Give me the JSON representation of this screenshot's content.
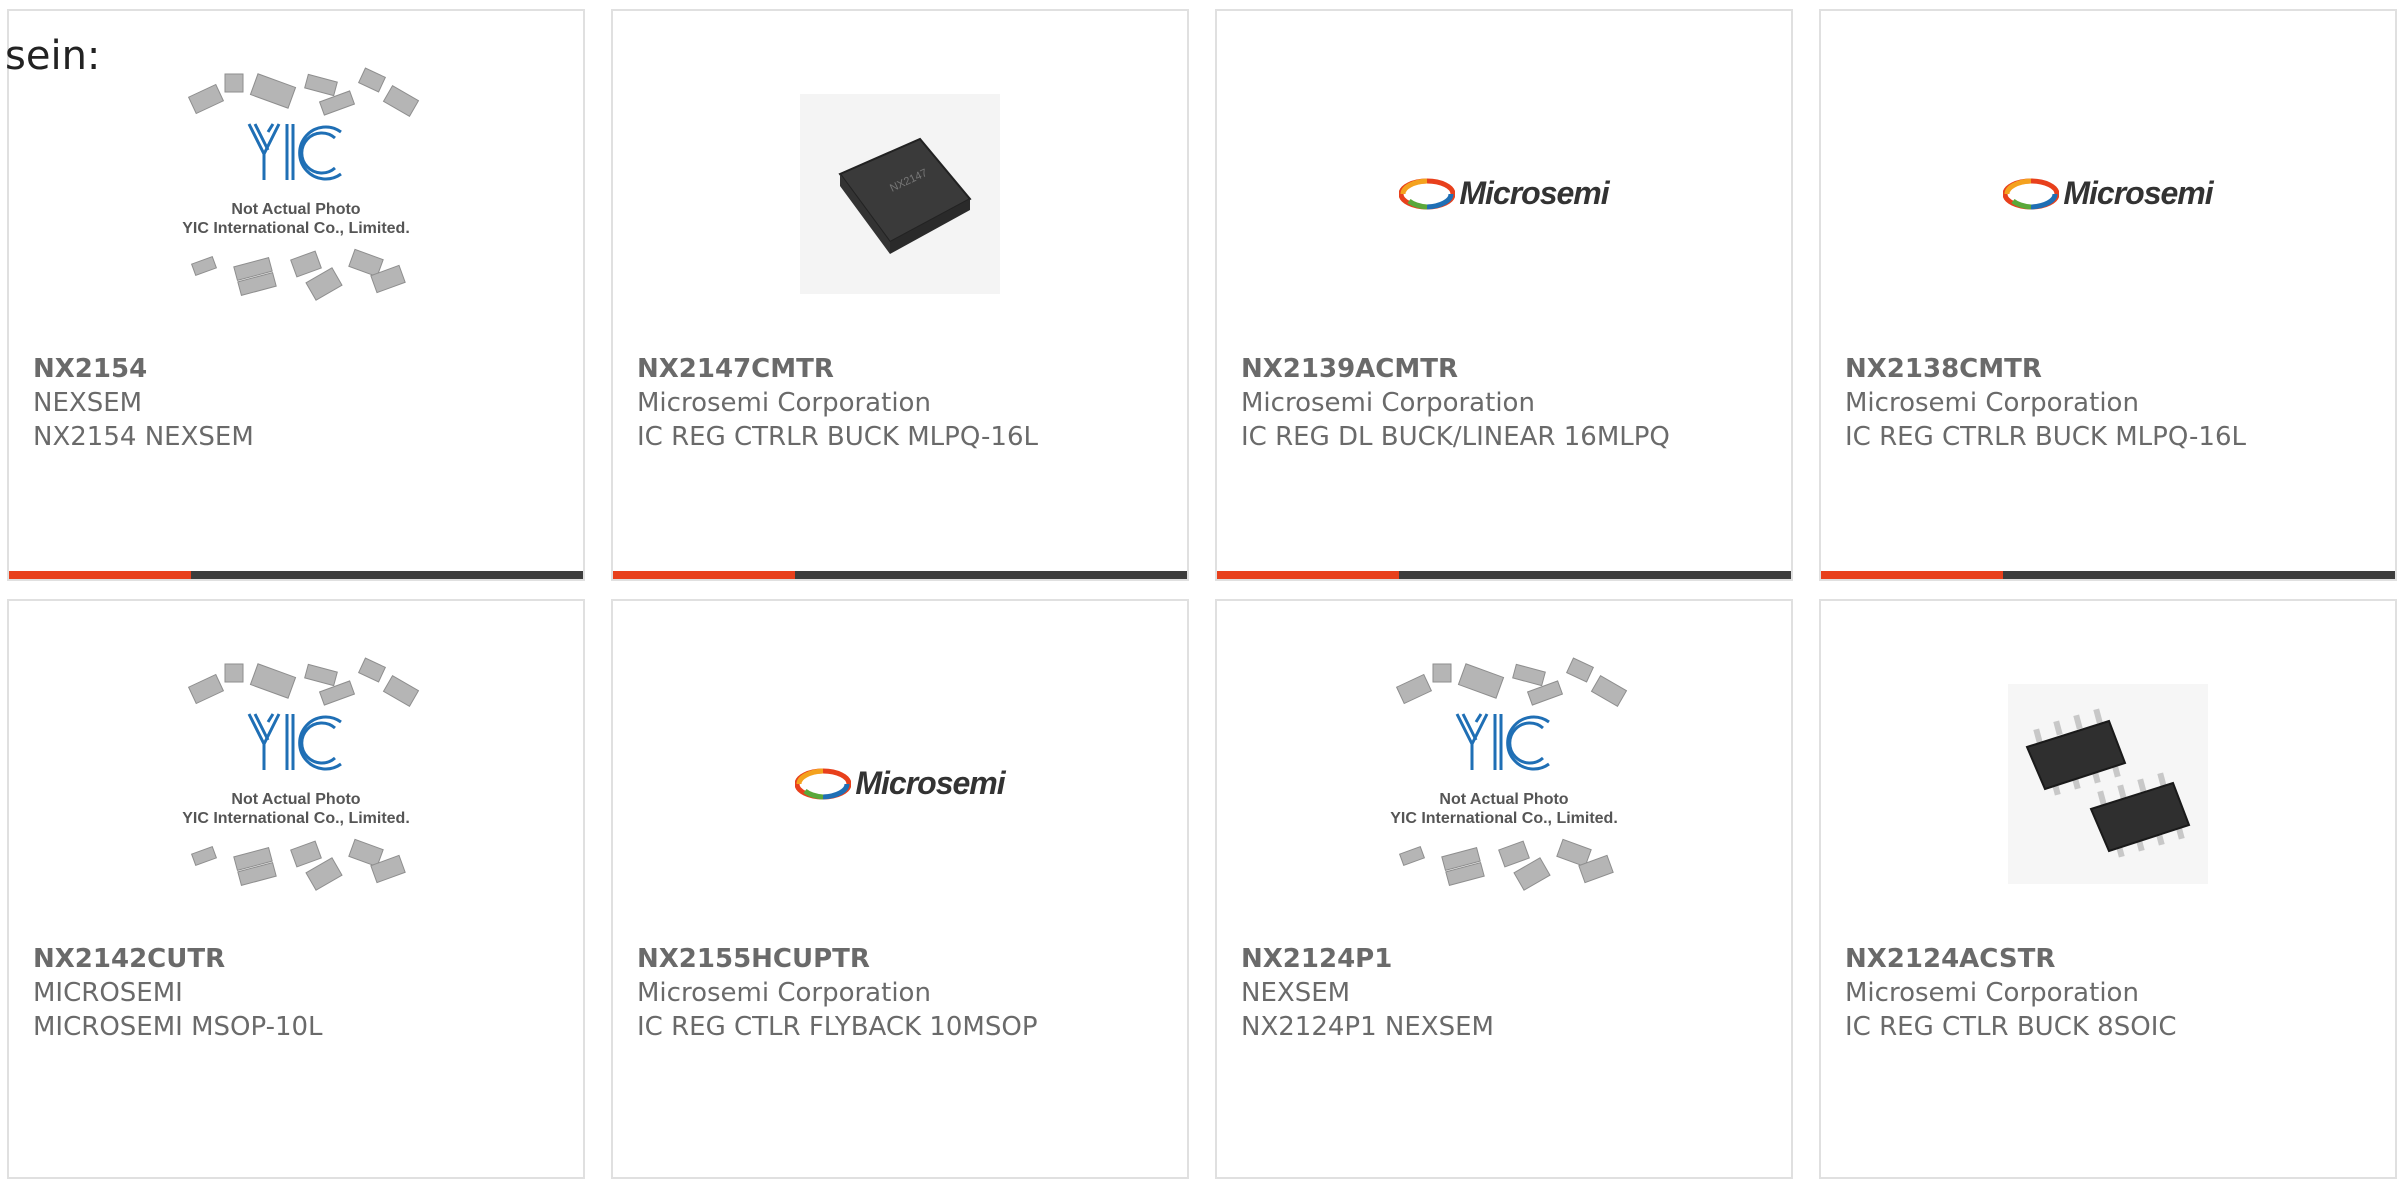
{
  "intro_text": "sein:",
  "colors": {
    "accent": "#e8401c",
    "bar": "#3c3c3c",
    "text": "#6a6a6a",
    "border": "#e0e0e0",
    "yic_blue": "#1f6fb5"
  },
  "yic_caption": {
    "line1": "Not Actual Photo",
    "line2": "YIC International Co., Limited."
  },
  "microsemi_logo_text": "Microsemi",
  "products": [
    {
      "part": "NX2154",
      "manufacturer": "NEXSEM",
      "description": "NX2154 NEXSEM",
      "image": "yic-placeholder"
    },
    {
      "part": "NX2147CMTR",
      "manufacturer": "Microsemi Corporation",
      "description": "IC REG CTRLR BUCK MLPQ-16L",
      "image": "qfn-chip"
    },
    {
      "part": "NX2139ACMTR",
      "manufacturer": "Microsemi Corporation",
      "description": "IC REG DL BUCK/LINEAR 16MLPQ",
      "image": "microsemi-logo"
    },
    {
      "part": "NX2138CMTR",
      "manufacturer": "Microsemi Corporation",
      "description": "IC REG CTRLR BUCK MLPQ-16L",
      "image": "microsemi-logo"
    },
    {
      "part": "NX2142CUTR",
      "manufacturer": "MICROSEMI",
      "description": "MICROSEMI MSOP-10L",
      "image": "yic-placeholder"
    },
    {
      "part": "NX2155HCUPTR",
      "manufacturer": "Microsemi Corporation",
      "description": "IC REG CTLR FLYBACK 10MSOP",
      "image": "microsemi-logo"
    },
    {
      "part": "NX2124P1",
      "manufacturer": "NEXSEM",
      "description": "NX2124P1 NEXSEM",
      "image": "yic-placeholder"
    },
    {
      "part": "NX2124ACSTR",
      "manufacturer": "Microsemi Corporation",
      "description": "IC REG CTLR BUCK 8SOIC",
      "image": "soic-chips"
    }
  ]
}
